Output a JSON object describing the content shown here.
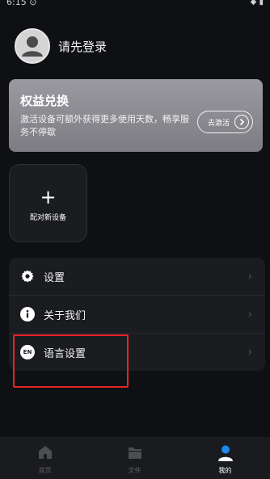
{
  "status_bar": {
    "time": "6:15  ⊙",
    "icons": "◆ ▮"
  },
  "profile": {
    "login_prompt": "请先登录"
  },
  "benefit_card": {
    "title": "权益兑换",
    "description": "激活设备可额外获得更多使用天数，畅享服务不停歇",
    "activate_label": "去激活"
  },
  "pair_card": {
    "plus": "+",
    "label": "配对新设备"
  },
  "menu": {
    "items": [
      {
        "label": "设置",
        "icon": "gear-icon"
      },
      {
        "label": "关于我们",
        "icon": "info-icon"
      },
      {
        "label": "语言设置",
        "icon": "language-en-icon",
        "icon_text": "EN"
      }
    ],
    "chevron": "›"
  },
  "tab_bar": {
    "tabs": [
      {
        "label": "首页",
        "icon": "home-icon",
        "active": false
      },
      {
        "label": "文件",
        "icon": "folder-icon",
        "active": false
      },
      {
        "label": "我的",
        "icon": "profile-icon",
        "active": true
      }
    ]
  },
  "colors": {
    "background": "#0f1013",
    "card": "#1b1c20",
    "active_tab_icon": "#1e88f0",
    "highlight": "#e8222a"
  }
}
